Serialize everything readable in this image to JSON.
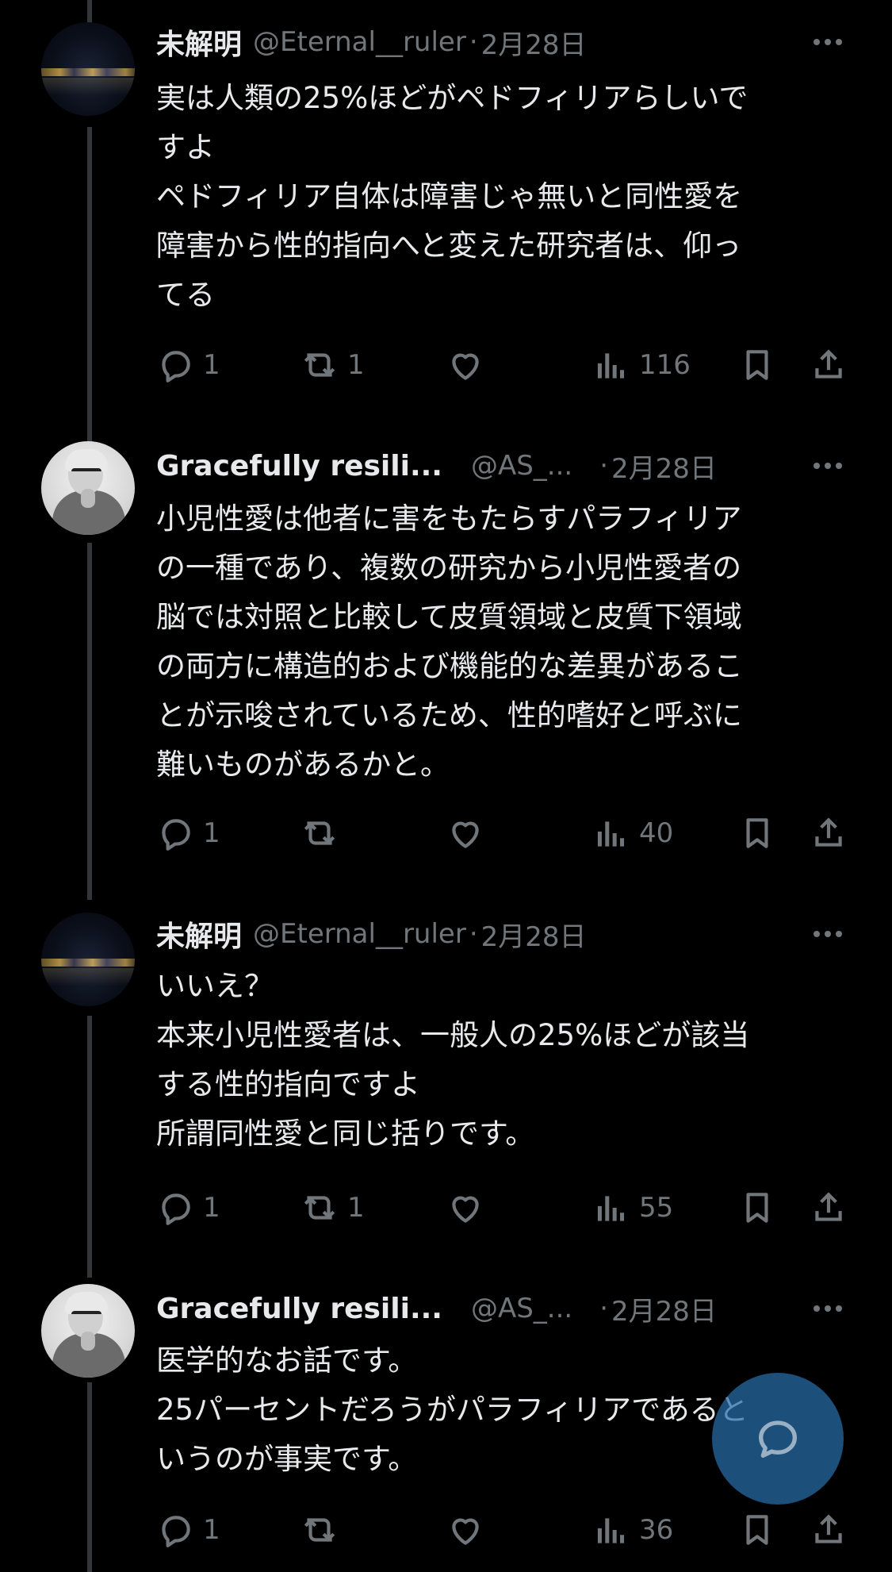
{
  "tweets": [
    {
      "name": "未解明",
      "handle": "@Eternal__ruler",
      "separator": "·",
      "date": "2月28日",
      "lines": [
        "実は人類の25%ほどがペドフィリアらしいで",
        "すよ",
        "ペドフィリア自体は障害じゃ無いと同性愛を",
        "障害から性的指向へと変えた研究者は、仰っ",
        "てる"
      ],
      "replies": "1",
      "reposts": "1",
      "likes": "",
      "views": "116",
      "avatar": "night-skyline-avatar"
    },
    {
      "name": "Gracefully resili...",
      "handle": "@AS_...",
      "separator": "·",
      "date": "2月28日",
      "lines": [
        "小児性愛は他者に害をもたらすパラフィリア",
        "の一種であり、複数の研究から小児性愛者の",
        "脳では対照と比較して皮質領域と皮質下領域",
        "の両方に構造的および機能的な差異があるこ",
        "とが示唆されているため、性的嗜好と呼ぶに",
        "難いものがあるかと。"
      ],
      "replies": "1",
      "reposts": "",
      "likes": "",
      "views": "40",
      "avatar": "grayscale-person-avatar"
    },
    {
      "name": "未解明",
      "handle": "@Eternal__ruler",
      "separator": "·",
      "date": "2月28日",
      "lines": [
        "いいえ？",
        "本来小児性愛者は、一般人の25%ほどが該当",
        "する性的指向ですよ",
        "所謂同性愛と同じ括りです。"
      ],
      "replies": "1",
      "reposts": "1",
      "likes": "",
      "views": "55",
      "avatar": "night-skyline-avatar"
    },
    {
      "name": "Gracefully resili...",
      "handle": "@AS_...",
      "separator": "·",
      "date": "2月28日",
      "lines": [
        "医学的なお話です。",
        "25パーセントだろうがパラフィリアであると",
        "いうのが事実です。"
      ],
      "replies": "1",
      "reposts": "",
      "likes": "",
      "views": "36",
      "avatar": "grayscale-person-avatar"
    }
  ],
  "icons": {
    "reply": "reply-icon",
    "repost": "repost-icon",
    "like": "heart-icon",
    "views": "views-icon",
    "bookmark": "bookmark-icon",
    "share": "share-icon",
    "more": "more-icon",
    "compose": "compose-reply-icon"
  },
  "colors": {
    "background": "#000000",
    "text": "#e7e9ea",
    "muted": "#71767b",
    "fab": "#286eaa"
  }
}
